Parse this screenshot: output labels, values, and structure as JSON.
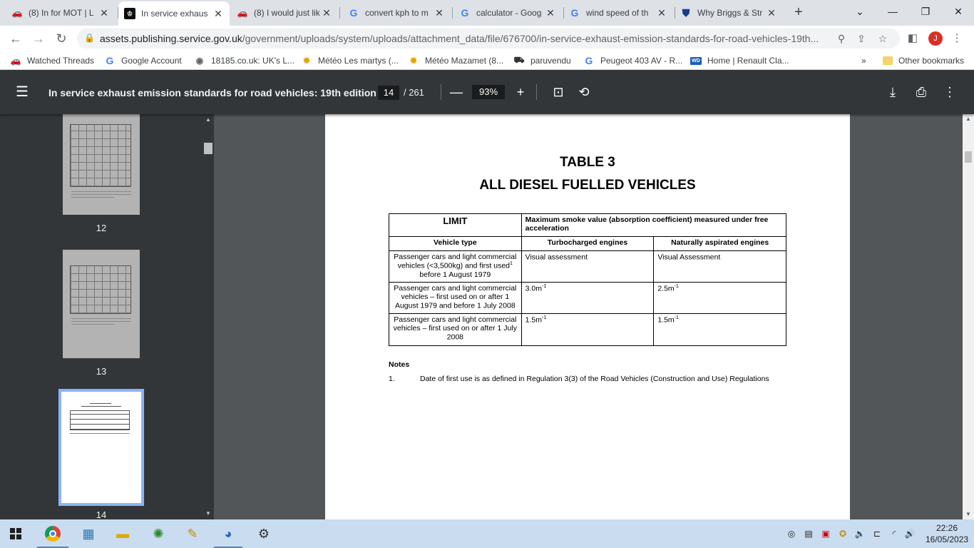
{
  "tabs": [
    {
      "title": "(8) In for MOT | L",
      "icon": "car-icon"
    },
    {
      "title": "In service exhaus",
      "icon": "crown-icon",
      "active": true
    },
    {
      "title": "(8) I would just lik",
      "icon": "car-icon"
    },
    {
      "title": "convert kph to m",
      "icon": "google-icon"
    },
    {
      "title": "calculator - Goog",
      "icon": "google-icon"
    },
    {
      "title": "wind speed of th",
      "icon": "google-icon"
    },
    {
      "title": "Why Briggs & Str",
      "icon": "shield-icon"
    }
  ],
  "address_bar": {
    "host": "assets.publishing.service.gov.uk",
    "path": "/government/uploads/system/uploads/attachment_data/file/676700/in-service-exhaust-emission-standards-for-road-vehicles-19th..."
  },
  "profile_initial": "J",
  "bookmarks": [
    {
      "label": "Watched Threads",
      "icon": "car-icon"
    },
    {
      "label": "Google Account",
      "icon": "google-icon"
    },
    {
      "label": "18185.co.uk: UK's L...",
      "icon": "globe-icon"
    },
    {
      "label": "Météo Les martys (...",
      "icon": "sun-icon"
    },
    {
      "label": "Météo Mazamet (8...",
      "icon": "sun-icon"
    },
    {
      "label": "paruvendu",
      "icon": "paruvendu-icon"
    },
    {
      "label": "Peugeot 403 AV - R...",
      "icon": "google-icon"
    },
    {
      "label": "Home | Renault Cla...",
      "icon": "wd-icon"
    }
  ],
  "bookmarks_overflow": "»",
  "other_bookmarks": "Other bookmarks",
  "pdf": {
    "title": "In service exhaust emission standards for road vehicles: 19th edition",
    "current_page": "14",
    "total_pages": "/ 261",
    "zoom": "93%"
  },
  "thumbnails": [
    {
      "label": "12"
    },
    {
      "label": "13"
    },
    {
      "label": "14"
    }
  ],
  "document": {
    "title_line1": "TABLE 3",
    "title_line2": "ALL DIESEL FUELLED VEHICLES",
    "table": {
      "limit_label": "LIMIT",
      "limit_description": "Maximum smoke value (absorption coefficient) measured under free acceleration",
      "col_vehicle_type": "Vehicle type",
      "col_turbo": "Turbocharged engines",
      "col_natural": "Naturally aspirated engines",
      "rows": [
        {
          "vehicle": "Passenger cars and light commercial vehicles (<3,500kg) and first used",
          "vehicle_sup": "1",
          "vehicle_tail": " before 1 August 1979",
          "turbo": "Visual assessment",
          "turbo_sup": "",
          "natural": "Visual Assessment",
          "natural_sup": ""
        },
        {
          "vehicle": "Passenger cars and light commercial vehicles – first used on or after 1 August 1979 and before 1 July 2008",
          "vehicle_sup": "",
          "vehicle_tail": "",
          "turbo": "3.0m",
          "turbo_sup": "-1",
          "natural": "2.5m",
          "natural_sup": "-1"
        },
        {
          "vehicle": "Passenger cars and light commercial vehicles – first used on or after 1 July 2008",
          "vehicle_sup": "",
          "vehicle_tail": "",
          "turbo": "1.5m",
          "turbo_sup": "-1",
          "natural": "1.5m",
          "natural_sup": "-1"
        }
      ]
    },
    "notes_label": "Notes",
    "notes": [
      {
        "num": "1.",
        "text": "Date of first use is as defined in Regulation 3(3) of the Road Vehicles (Construction and Use) Regulations"
      }
    ]
  },
  "taskbar": {
    "time": "22:26",
    "date": "16/05/2023"
  }
}
